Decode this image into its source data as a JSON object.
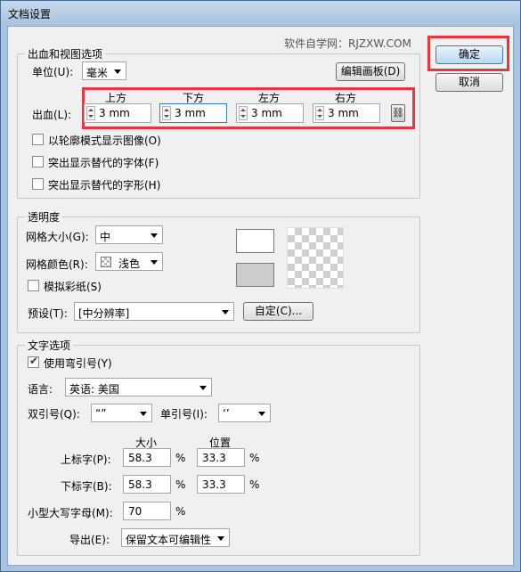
{
  "window": {
    "title": "文档设置"
  },
  "watermark": "软件自学网：RJZXW.COM",
  "buttons": {
    "ok": "确定",
    "cancel": "取消",
    "edit_artboards": "编辑画板(D)",
    "custom": "自定(C)..."
  },
  "bleed_view": {
    "legend": "出血和视图选项",
    "units_label": "单位(U):",
    "units_value": "毫米",
    "bleed_label": "出血(L):",
    "headers": {
      "top": "上方",
      "bottom": "下方",
      "left": "左方",
      "right": "右方"
    },
    "values": {
      "top": "3 mm",
      "bottom": "3 mm",
      "left": "3 mm",
      "right": "3 mm"
    },
    "link_icon": "chain-link-icon",
    "options": [
      {
        "label": "以轮廓模式显示图像(O)",
        "checked": false
      },
      {
        "label": "突出显示替代的字体(F)",
        "checked": false
      },
      {
        "label": "突出显示替代的字形(H)",
        "checked": false
      }
    ]
  },
  "transparency": {
    "legend": "透明度",
    "grid_size_label": "网格大小(G):",
    "grid_size_value": "中",
    "grid_color_label": "网格颜色(R):",
    "grid_color_value": "浅色",
    "simulate_paper_label": "模拟彩纸(S)",
    "simulate_paper_checked": false,
    "preset_label": "预设(T):",
    "preset_value": "[中分辨率]"
  },
  "type_options": {
    "legend": "文字选项",
    "smart_quotes_label": "使用弯引号(Y)",
    "smart_quotes_checked": true,
    "language_label": "语言:",
    "language_value": "英语: 美国",
    "double_quotes_label": "双引号(Q):",
    "double_quotes_value": "“”",
    "single_quotes_label": "单引号(I):",
    "single_quotes_value": "‘’",
    "size_header": "大小",
    "position_header": "位置",
    "superscript_label": "上标字(P):",
    "superscript_size": "58.3",
    "superscript_position": "33.3",
    "subscript_label": "下标字(B):",
    "subscript_size": "58.3",
    "subscript_position": "33.3",
    "percent": "%",
    "small_caps_label": "小型大写字母(M):",
    "small_caps_value": "70",
    "export_label": "导出(E):",
    "export_value": "保留文本可编辑性"
  },
  "colors": {
    "highlight": "#e8373b",
    "focus_border": "#3c7fb1"
  }
}
